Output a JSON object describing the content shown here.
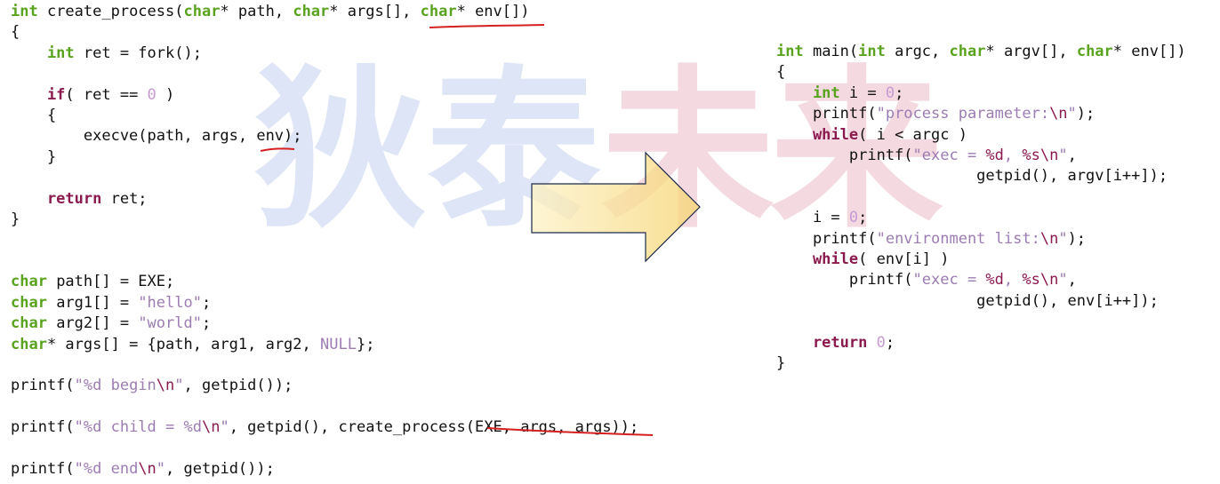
{
  "watermark": {
    "char1": "狄",
    "char2": "泰",
    "char3": "未",
    "char4": "来"
  },
  "left": {
    "l1_kw1": "int",
    "l1_fn": " create_process(",
    "l1_kw2": "char",
    "l1_p1": "* path, ",
    "l1_kw3": "char",
    "l1_p2": "* args[], ",
    "l1_kw4": "char",
    "l1_p3": "* env[])",
    "l2": "{",
    "l3_kw": "    int",
    "l3_rest": " ret = fork();",
    "l5_kw": "    if",
    "l5_a": "( ret == ",
    "l5_num": "0",
    "l5_b": " )",
    "l6": "    {",
    "l7": "        execve(path, args, env);",
    "l8": "    }",
    "l10_kw": "    return",
    "l10_rest": " ret;",
    "l11": "}",
    "d1_kw": "char",
    "d1_rest": " path[] = EXE;",
    "d2_kw": "char",
    "d2_a": " arg1[] = ",
    "d2_str": "\"hello\"",
    "d2_b": ";",
    "d3_kw": "char",
    "d3_a": " arg2[] = ",
    "d3_str": "\"world\"",
    "d3_b": ";",
    "d4_kw": "char",
    "d4_a": "* args[] = {path, arg1, arg2, ",
    "d4_null": "NULL",
    "d4_b": "};",
    "p1_a": "printf(",
    "p1_s1": "\"%d begin",
    "p1_esc": "\\n",
    "p1_s2": "\"",
    "p1_b": ", getpid());",
    "p2_a": "printf(",
    "p2_s1": "\"%d child = %d",
    "p2_esc": "\\n",
    "p2_s2": "\"",
    "p2_b": ", getpid(), create_process(EXE, args, args));",
    "p3_a": "printf(",
    "p3_s1": "\"%d end",
    "p3_esc": "\\n",
    "p3_s2": "\"",
    "p3_b": ", getpid());"
  },
  "right": {
    "r1_kw1": "int",
    "r1_a": " main(",
    "r1_kw2": "int",
    "r1_b": " argc, ",
    "r1_kw3": "char",
    "r1_c": "* argv[], ",
    "r1_kw4": "char",
    "r1_d": "* env[])",
    "r2": "{",
    "r3_kw": "    int",
    "r3_a": " i = ",
    "r3_num": "0",
    "r3_b": ";",
    "r4_a": "    printf(",
    "r4_s1": "\"process parameter:",
    "r4_esc": "\\n",
    "r4_s2": "\"",
    "r4_b": ");",
    "r5_kw": "    while",
    "r5_rest": "( i < argc )",
    "r6_a": "        printf(",
    "r6_s1": "\"exec = ",
    "r6_e1": "%d",
    "r6_s2": ", ",
    "r6_e2": "%s\\n",
    "r6_s3": "\"",
    "r6_b": ",",
    "r7": "                      getpid(), argv[i++]);",
    "r9_a": "    i = ",
    "r9_num": "0",
    "r9_b": ";",
    "r10_a": "    printf(",
    "r10_s1": "\"environment list:",
    "r10_esc": "\\n",
    "r10_s2": "\"",
    "r10_b": ");",
    "r11_kw": "    while",
    "r11_rest": "( env[i] )",
    "r12_a": "        printf(",
    "r12_s1": "\"exec = ",
    "r12_e1": "%d",
    "r12_s2": ", ",
    "r12_e2": "%s\\n",
    "r12_s3": "\"",
    "r12_b": ",",
    "r13": "                      getpid(), env[i++]);",
    "r15_kw": "    return",
    "r15_a": " ",
    "r15_num": "0",
    "r15_b": ";",
    "r16": "}"
  },
  "colors": {
    "keyword": "#5aa31f",
    "control": "#8b1a4f",
    "string": "#9d7cb3",
    "underline": "#d42020",
    "arrow_fill": "#fbe7a8"
  }
}
